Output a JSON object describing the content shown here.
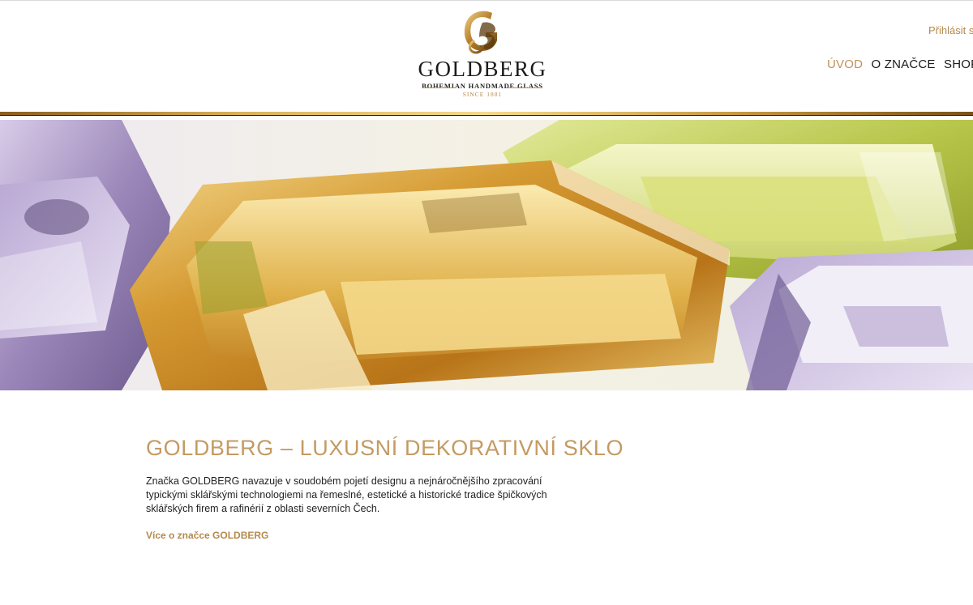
{
  "header": {
    "logo": {
      "brand": "GOLDBERG",
      "tagline": "BOHEMIAN HANDMADE GLASS",
      "since": "SINCE 1881"
    },
    "login_label": "Přihlásit s",
    "nav": [
      {
        "label": "ÚVOD",
        "active": true
      },
      {
        "label": "O ZNAČCE",
        "active": false
      },
      {
        "label": "SHOP",
        "active": false
      }
    ]
  },
  "hero": {
    "image": "colored-glass-bowls-photo"
  },
  "main": {
    "title": "GOLDBERG – LUXUSNÍ DEKORATIVNÍ SKLO",
    "paragraph": "Značka GOLDBERG navazuje v soudobém pojetí designu a nejnáročnějšího zpracování typickými sklářskými technologiemi na řemeslné, estetické a historické tradice špičkových sklářských firem a rafinérií z oblasti severních Čech.",
    "more_link": "Více o značce GOLDBERG"
  },
  "colors": {
    "accent_gold": "#c49a62",
    "nav_active": "#c0915a",
    "text": "#222222"
  }
}
